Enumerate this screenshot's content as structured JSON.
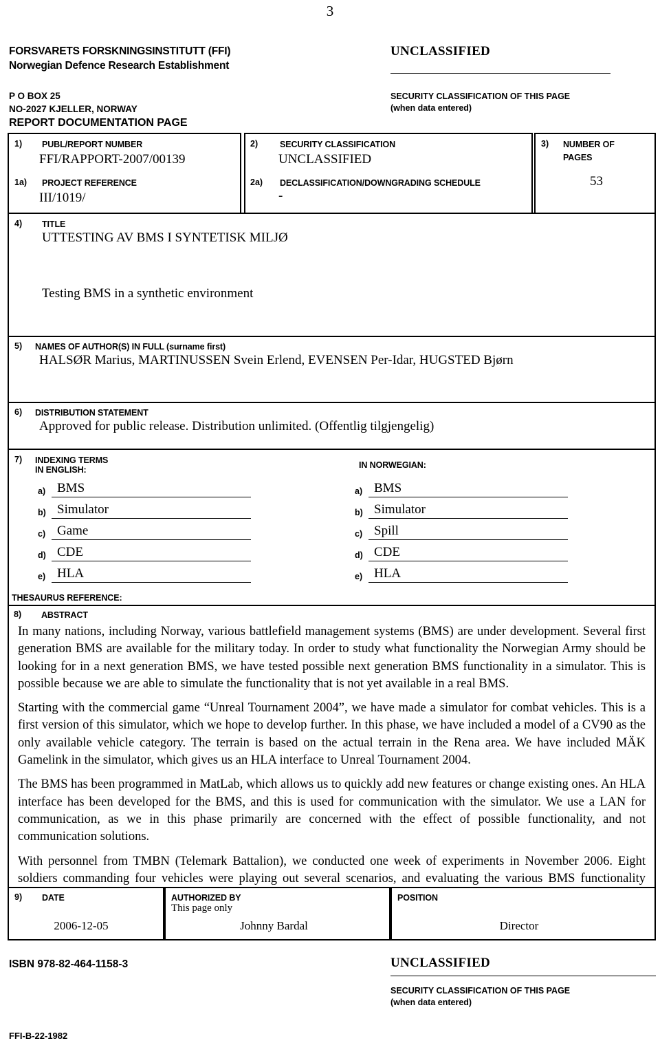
{
  "page_number": "3",
  "header": {
    "org_name_1": "FORSVARETS FORSKNINGSINSTITUTT (FFI)",
    "org_name_2": "Norwegian Defence Research Establishment",
    "address_1": "P O BOX 25",
    "address_2": "NO-2027 KJELLER, NORWAY",
    "form_title": "REPORT DOCUMENTATION PAGE",
    "classification": "UNCLASSIFIED",
    "security_note_1": "SECURITY CLASSIFICATION OF THIS PAGE",
    "security_note_2": "(when data entered)"
  },
  "fields": {
    "f1_num": "1)",
    "f1_label": "PUBL/REPORT NUMBER",
    "f1_value": "FFI/RAPPORT-2007/00139",
    "f1a_num": "1a)",
    "f1a_label": "PROJECT REFERENCE",
    "f1a_value": "III/1019/",
    "f2_num": "2)",
    "f2_label": "SECURITY CLASSIFICATION",
    "f2_value": "UNCLASSIFIED",
    "f2a_num": "2a)",
    "f2a_label": "DECLASSIFICATION/DOWNGRADING SCHEDULE",
    "f2a_value": "-",
    "f3_num": "3)",
    "f3_label_1": "NUMBER OF",
    "f3_label_2": "PAGES",
    "f3_value": "53",
    "f4_num": "4)",
    "f4_label": "TITLE",
    "f4_title_no": "UTTESTING AV BMS I SYNTETISK MILJØ",
    "f4_title_en": "Testing BMS in a synthetic environment",
    "f5_num": "5)",
    "f5_label": "NAMES OF AUTHOR(S) IN FULL (surname first)",
    "f5_value": "HALSØR Marius, MARTINUSSEN Svein Erlend, EVENSEN Per-Idar, HUGSTED Bjørn",
    "f6_num": "6)",
    "f6_label": "DISTRIBUTION STATEMENT",
    "f6_value": "Approved for public release. Distribution unlimited. (Offentlig tilgjengelig)",
    "f7_num": "7)",
    "f7_label_1": "INDEXING TERMS",
    "f7_label_2": "IN ENGLISH:",
    "f7_label_no": "IN NORWEGIAN:",
    "thesaurus_label": "THESAURUS REFERENCE:",
    "f8_num": "8)",
    "f8_label": "ABSTRACT"
  },
  "indexing": {
    "english": [
      {
        "letter": "a)",
        "term": "BMS"
      },
      {
        "letter": "b)",
        "term": "Simulator"
      },
      {
        "letter": "c)",
        "term": "Game"
      },
      {
        "letter": "d)",
        "term": "CDE"
      },
      {
        "letter": "e)",
        "term": "HLA"
      }
    ],
    "norwegian": [
      {
        "letter": "a)",
        "term": "BMS"
      },
      {
        "letter": "b)",
        "term": "Simulator"
      },
      {
        "letter": "c)",
        "term": "Spill"
      },
      {
        "letter": "d)",
        "term": "CDE"
      },
      {
        "letter": "e)",
        "term": "HLA"
      }
    ]
  },
  "abstract": {
    "p1": "In many nations, including Norway, various battlefield management systems (BMS) are under development. Several first generation BMS are available for the military today. In order to study what functionality the Norwegian Army should be looking for in a next generation BMS, we have tested possible next generation BMS functionality in a simulator. This is possible because we are able to simulate the functionality that is not yet available in a real BMS.",
    "p2": "Starting with the commercial game “Unreal Tournament 2004”, we have made a simulator for combat vehicles. This is a first version of this simulator, which we hope to develop further. In this phase, we have included a model of a CV90 as the only available vehicle category. The terrain is based on the actual terrain in the Rena area. We have included MÄK Gamelink in the simulator, which gives us an HLA interface to Unreal Tournament 2004.",
    "p3": "The BMS has been programmed in MatLab, which allows us to quickly add new features or change existing ones. An HLA interface has been developed for the BMS, and this is used for communication with the simulator. We use a LAN for communication, as we in this phase primarily are concerned with the effect of possible functionality, and not communication solutions.",
    "p4": "With personnel from TMBN (Telemark Battalion), we conducted one week of experiments in November 2006. Eight soldiers commanding four vehicles were playing out several scenarios, and evaluating the various BMS functionality available in each separate scenario. The results from these experiments are presented in this report."
  },
  "signature": {
    "f9_num": "9)",
    "date_label": "DATE",
    "date_value": "2006-12-05",
    "authorized_label": "AUTHORIZED BY",
    "authorized_sub": "This page only",
    "authorized_value": "Johnny Bardal",
    "position_label": "POSITION",
    "position_value": "Director"
  },
  "footer": {
    "isbn": "ISBN 978-82-464-1158-3",
    "classification": "UNCLASSIFIED",
    "security_note_1": "SECURITY CLASSIFICATION OF THIS PAGE",
    "security_note_2": "(when data entered)",
    "form_code": "FFI-B-22-1982"
  }
}
